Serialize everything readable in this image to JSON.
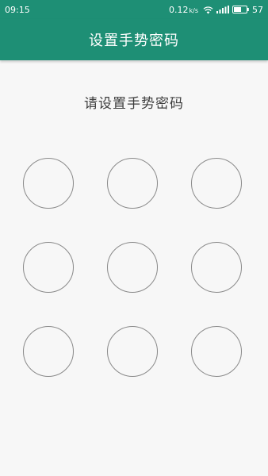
{
  "status_bar": {
    "time": "09:15",
    "network_speed": "0.12",
    "network_speed_unit": "k/s",
    "battery_level": "57",
    "icons": [
      "wifi-icon",
      "signal-icon",
      "battery-icon"
    ]
  },
  "app_bar": {
    "title": "设置手势密码"
  },
  "prompt": "请设置手势密码",
  "pattern": {
    "rows": 3,
    "cols": 3,
    "dots": [
      1,
      2,
      3,
      4,
      5,
      6,
      7,
      8,
      9
    ]
  },
  "colors": {
    "primary": "#1e8f75",
    "background": "#f7f7f7",
    "dot_border": "#8a8a8a",
    "prompt_text": "#3c3c3c"
  }
}
